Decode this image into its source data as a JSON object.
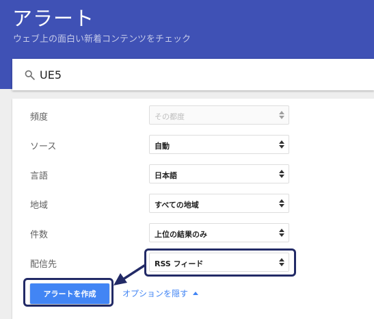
{
  "header": {
    "title": "アラート",
    "subtitle": "ウェブ上の面白い新着コンテンツをチェック"
  },
  "search": {
    "value": "UE5",
    "icon": "search-icon"
  },
  "options": {
    "rows": [
      {
        "label": "頻度",
        "value": "その都度",
        "disabled": true
      },
      {
        "label": "ソース",
        "value": "自動"
      },
      {
        "label": "言語",
        "value": "日本語"
      },
      {
        "label": "地域",
        "value": "すべての地域"
      },
      {
        "label": "件数",
        "value": "上位の結果のみ"
      },
      {
        "label": "配信先",
        "value": "RSS フィード"
      }
    ]
  },
  "actions": {
    "create_label": "アラートを作成",
    "options_link_label": "オプションを隠す"
  },
  "colors": {
    "header": "#3f51b5",
    "button": "#4285f4",
    "annotation": "#222a66"
  }
}
